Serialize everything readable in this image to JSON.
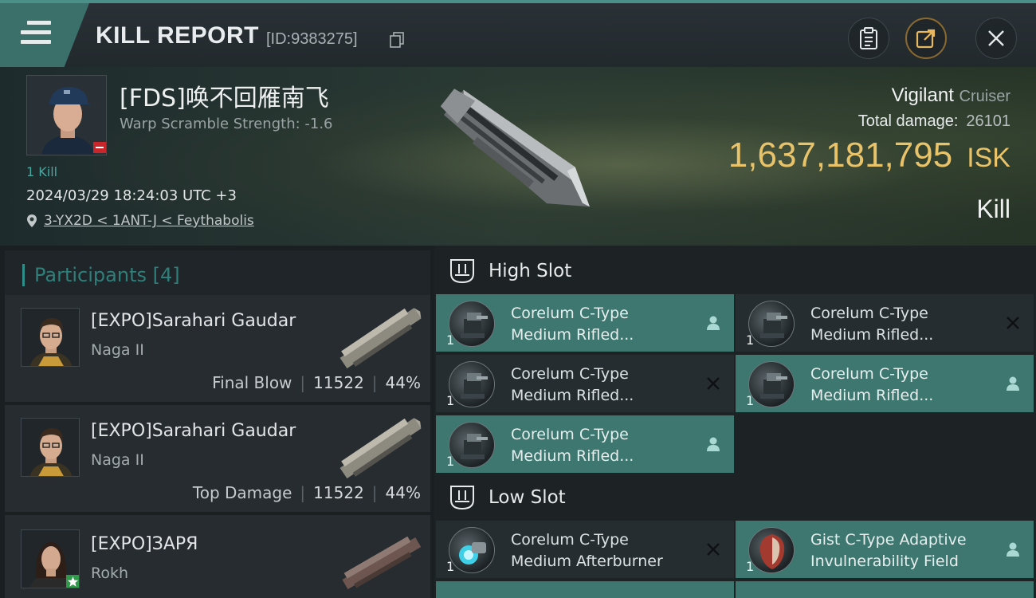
{
  "header": {
    "title": "KILL REPORT",
    "report_id": "[ID:9383275]"
  },
  "victim": {
    "name": "[FDS]唤不回雁南飞",
    "warp_scramble": "Warp Scramble Strength: -1.6",
    "kills": "1 Kill",
    "datetime": "2024/03/29 18:24:03 UTC +3",
    "location": "3-YX2D < 1ANT-J < Feythabolis"
  },
  "ship": {
    "name": "Vigilant",
    "class": "Cruiser",
    "total_damage_label": "Total damage:",
    "total_damage": "26101",
    "isk_value": "1,637,181,795",
    "isk_unit": "ISK",
    "result": "Kill"
  },
  "participants": {
    "title": "Participants",
    "count": "[4]",
    "rows": [
      {
        "name": "[EXPO]Sarahari Gaudar",
        "ship": "Naga II",
        "label": "Final Blow",
        "damage": "11522",
        "percent": "44%"
      },
      {
        "name": "[EXPO]Sarahari Gaudar",
        "ship": "Naga II",
        "label": "Top Damage",
        "damage": "11522",
        "percent": "44%"
      },
      {
        "name": "[EXPO]ЗАРЯ",
        "ship": "Rokh",
        "label": "",
        "damage": "",
        "percent": ""
      }
    ]
  },
  "fitting": {
    "high_slot_title": "High Slot",
    "low_slot_title": "Low Slot",
    "high_slots": [
      {
        "line1": "Corelum C-Type",
        "line2": "Medium Rifled...",
        "qty": "1",
        "status": "dropped"
      },
      {
        "line1": "Corelum C-Type",
        "line2": "Medium Rifled...",
        "qty": "1",
        "status": "destroyed"
      },
      {
        "line1": "Corelum C-Type",
        "line2": "Medium Rifled...",
        "qty": "1",
        "status": "destroyed"
      },
      {
        "line1": "Corelum C-Type",
        "line2": "Medium Rifled...",
        "qty": "1",
        "status": "dropped"
      },
      {
        "line1": "Corelum C-Type",
        "line2": "Medium Rifled...",
        "qty": "1",
        "status": "dropped"
      }
    ],
    "low_slots": [
      {
        "line1": "Corelum C-Type",
        "line2": "Medium Afterburner",
        "qty": "1",
        "status": "destroyed"
      },
      {
        "line1": "Gist C-Type Adaptive",
        "line2": "Invulnerability Field",
        "qty": "1",
        "status": "dropped"
      }
    ]
  },
  "colors": {
    "accent_teal": "#3d7770",
    "isk_gold": "#e8c36a"
  }
}
